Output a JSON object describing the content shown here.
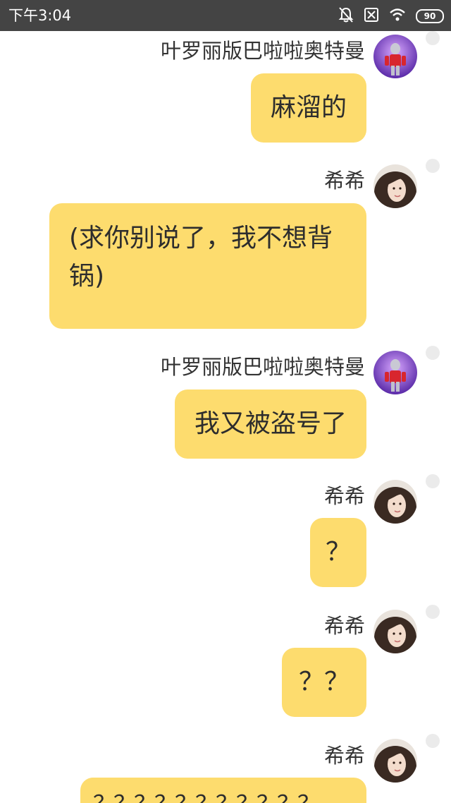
{
  "status_bar": {
    "time": "下午3:04",
    "battery": "90",
    "icons": [
      "bell-muted-icon",
      "no-sim-icon",
      "wifi-icon",
      "battery-icon"
    ]
  },
  "messages": [
    {
      "sender": "叶罗丽版巴啦啦奥特曼",
      "avatar": "ultraman-avatar",
      "text": "麻溜的"
    },
    {
      "sender": "希希",
      "avatar": "girl-avatar",
      "text": "(求你别说了，我不想背锅)"
    },
    {
      "sender": "叶罗丽版巴啦啦奥特曼",
      "avatar": "ultraman-avatar",
      "text": "我又被盗号了"
    },
    {
      "sender": "希希",
      "avatar": "girl-avatar",
      "text": "？"
    },
    {
      "sender": "希希",
      "avatar": "girl-avatar",
      "text": "？？"
    },
    {
      "sender": "希希",
      "avatar": "girl-avatar",
      "text": "？？？？？？？？？？？"
    }
  ],
  "colors": {
    "bubble": "#fddc6e",
    "status_bar": "#444444"
  }
}
